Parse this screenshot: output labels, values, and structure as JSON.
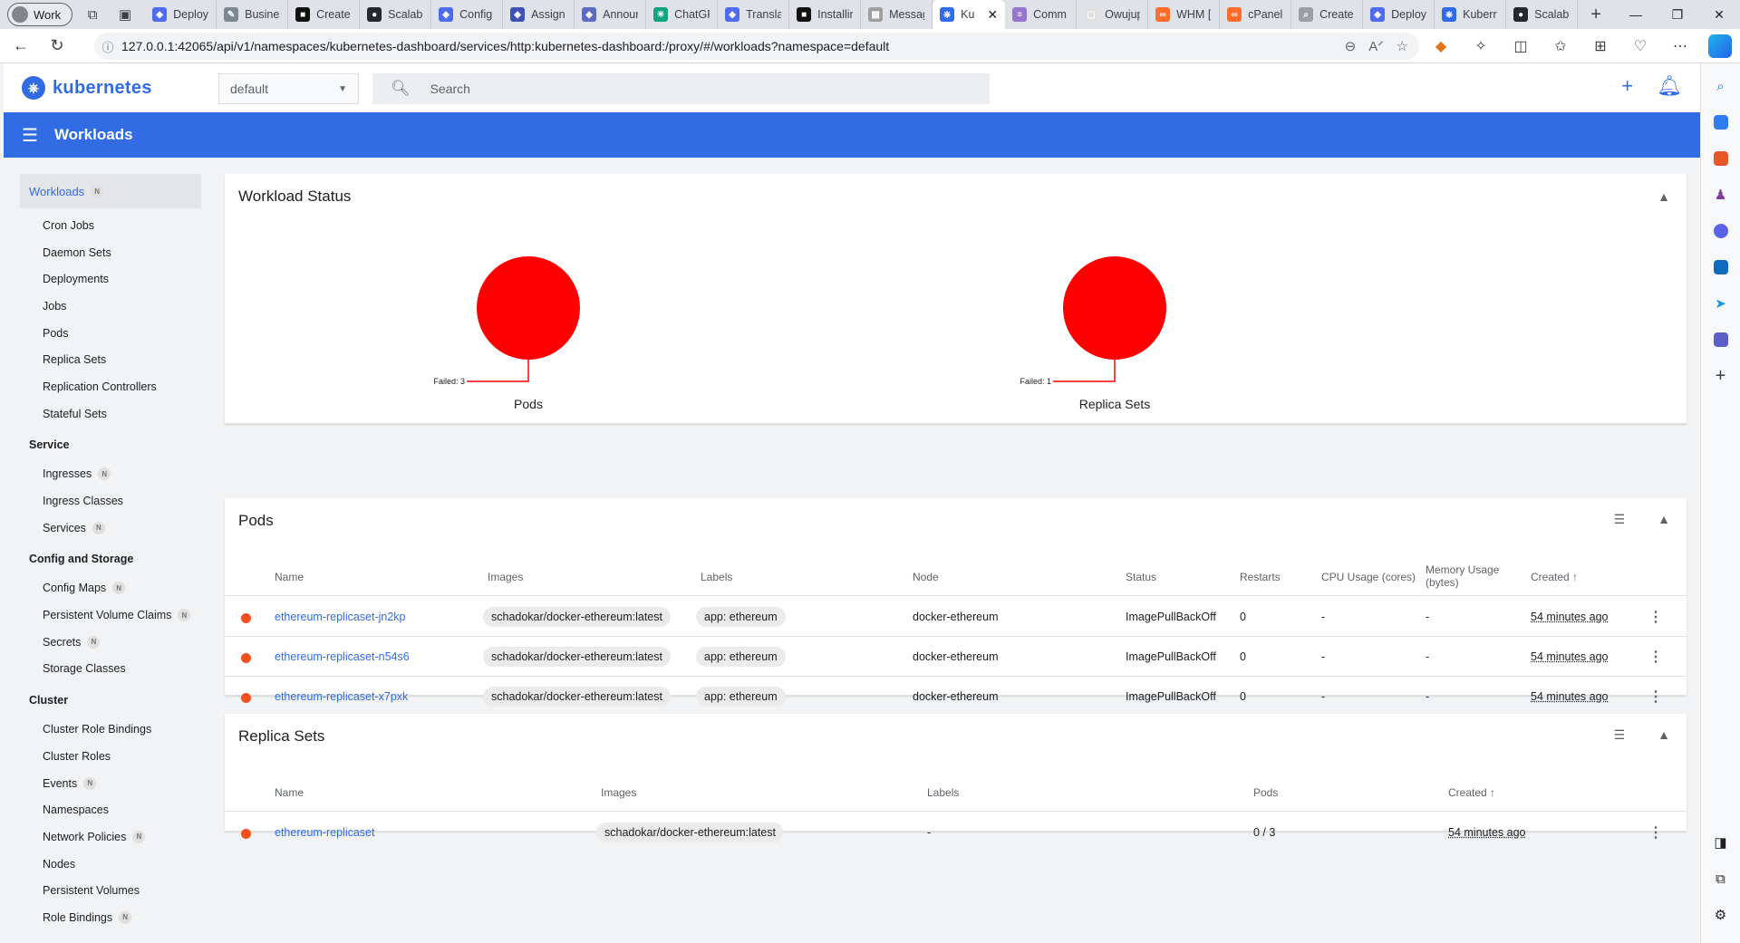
{
  "browser": {
    "profile": "Work",
    "tabs": [
      {
        "label": "Deploy",
        "color": "#4f6bed",
        "glyph": "◈"
      },
      {
        "label": "Busines",
        "color": "#7b8794",
        "glyph": "✎"
      },
      {
        "label": "Create",
        "color": "#111111",
        "glyph": "■"
      },
      {
        "label": "Scalabl",
        "color": "#24292f",
        "glyph": "●"
      },
      {
        "label": "Config",
        "color": "#4f6bed",
        "glyph": "◈"
      },
      {
        "label": "Assign",
        "color": "#3f51b5",
        "glyph": "◈"
      },
      {
        "label": "Annour",
        "color": "#5c6bc0",
        "glyph": "◈"
      },
      {
        "label": "ChatGF",
        "color": "#10a37f",
        "glyph": "✳"
      },
      {
        "label": "Translat",
        "color": "#4f6bed",
        "glyph": "◈"
      },
      {
        "label": "Installin",
        "color": "#111111",
        "glyph": "■"
      },
      {
        "label": "Messag",
        "color": "#9e9e9e",
        "glyph": "▦"
      },
      {
        "label": "Ku",
        "color": "#326ce5",
        "glyph": "⎈",
        "active": true
      },
      {
        "label": "Comm",
        "color": "#9575cd",
        "glyph": "≡"
      },
      {
        "label": "Owujup",
        "color": "#e0e0e0",
        "glyph": "▢"
      },
      {
        "label": "WHM [",
        "color": "#ff6c2c",
        "glyph": "∞"
      },
      {
        "label": "cPanel",
        "color": "#ff6c2c",
        "glyph": "∞"
      },
      {
        "label": "Create",
        "color": "#9aa0a6",
        "glyph": "⌕"
      },
      {
        "label": "Deploy",
        "color": "#4f6bed",
        "glyph": "◈"
      },
      {
        "label": "Kuberr",
        "color": "#326ce5",
        "glyph": "⎈"
      },
      {
        "label": "Scalabl",
        "color": "#24292f",
        "glyph": "●"
      }
    ],
    "url": "127.0.0.1:42065/api/v1/namespaces/kubernetes-dashboard/services/http:kubernetes-dashboard:/proxy/#/workloads?namespace=default"
  },
  "app": {
    "brand": "kubernetes",
    "namespace": "default",
    "search_placeholder": "Search",
    "page_title": "Workloads"
  },
  "sidebar": {
    "active": {
      "label": "Workloads",
      "badge": "N"
    },
    "workloads": [
      {
        "label": "Cron Jobs"
      },
      {
        "label": "Daemon Sets"
      },
      {
        "label": "Deployments"
      },
      {
        "label": "Jobs"
      },
      {
        "label": "Pods"
      },
      {
        "label": "Replica Sets"
      },
      {
        "label": "Replication Controllers"
      },
      {
        "label": "Stateful Sets"
      }
    ],
    "service_header": "Service",
    "service": [
      {
        "label": "Ingresses",
        "badge": "N"
      },
      {
        "label": "Ingress Classes"
      },
      {
        "label": "Services",
        "badge": "N"
      }
    ],
    "config_header": "Config and Storage",
    "config": [
      {
        "label": "Config Maps",
        "badge": "N"
      },
      {
        "label": "Persistent Volume Claims",
        "badge": "N"
      },
      {
        "label": "Secrets",
        "badge": "N"
      },
      {
        "label": "Storage Classes"
      }
    ],
    "cluster_header": "Cluster",
    "cluster": [
      {
        "label": "Cluster Role Bindings"
      },
      {
        "label": "Cluster Roles"
      },
      {
        "label": "Events",
        "badge": "N"
      },
      {
        "label": "Namespaces"
      },
      {
        "label": "Network Policies",
        "badge": "N"
      },
      {
        "label": "Nodes"
      },
      {
        "label": "Persistent Volumes"
      },
      {
        "label": "Role Bindings",
        "badge": "N"
      }
    ]
  },
  "workload_status": {
    "title": "Workload Status",
    "charts": [
      {
        "name": "Pods",
        "slice_label": "Failed: 3",
        "failed": 3,
        "color": "#ff0000"
      },
      {
        "name": "Replica Sets",
        "slice_label": "Failed: 1",
        "failed": 1,
        "color": "#ff0000"
      }
    ]
  },
  "pods": {
    "title": "Pods",
    "columns": {
      "name": "Name",
      "images": "Images",
      "labels": "Labels",
      "node": "Node",
      "status": "Status",
      "restarts": "Restarts",
      "cpu": "CPU Usage (cores)",
      "memory_1": "Memory Usage",
      "memory_2": "(bytes)",
      "created": "Created ↑"
    },
    "rows": [
      {
        "name": "ethereum-replicaset-jn2kp",
        "image": "schadokar/docker-ethereum:latest",
        "label": "app: ethereum",
        "node": "docker-ethereum",
        "status": "ImagePullBackOff",
        "restarts": "0",
        "cpu": "-",
        "memory": "-",
        "created": "54 minutes ago"
      },
      {
        "name": "ethereum-replicaset-n54s6",
        "image": "schadokar/docker-ethereum:latest",
        "label": "app: ethereum",
        "node": "docker-ethereum",
        "status": "ImagePullBackOff",
        "restarts": "0",
        "cpu": "-",
        "memory": "-",
        "created": "54 minutes ago"
      },
      {
        "name": "ethereum-replicaset-x7pxk",
        "image": "schadokar/docker-ethereum:latest",
        "label": "app: ethereum",
        "node": "docker-ethereum",
        "status": "ImagePullBackOff",
        "restarts": "0",
        "cpu": "-",
        "memory": "-",
        "created": "54 minutes ago"
      }
    ]
  },
  "replica_sets": {
    "title": "Replica Sets",
    "columns": {
      "name": "Name",
      "images": "Images",
      "labels": "Labels",
      "pods": "Pods",
      "created": "Created ↑"
    },
    "rows": [
      {
        "name": "ethereum-replicaset",
        "image": "schadokar/docker-ethereum:latest",
        "labels": "-",
        "pods": "0 / 3",
        "created": "54 minutes ago"
      }
    ]
  },
  "colors": {
    "accent": "#326ce5",
    "error": "#f44f1e",
    "chart_failed": "#ff0000"
  }
}
